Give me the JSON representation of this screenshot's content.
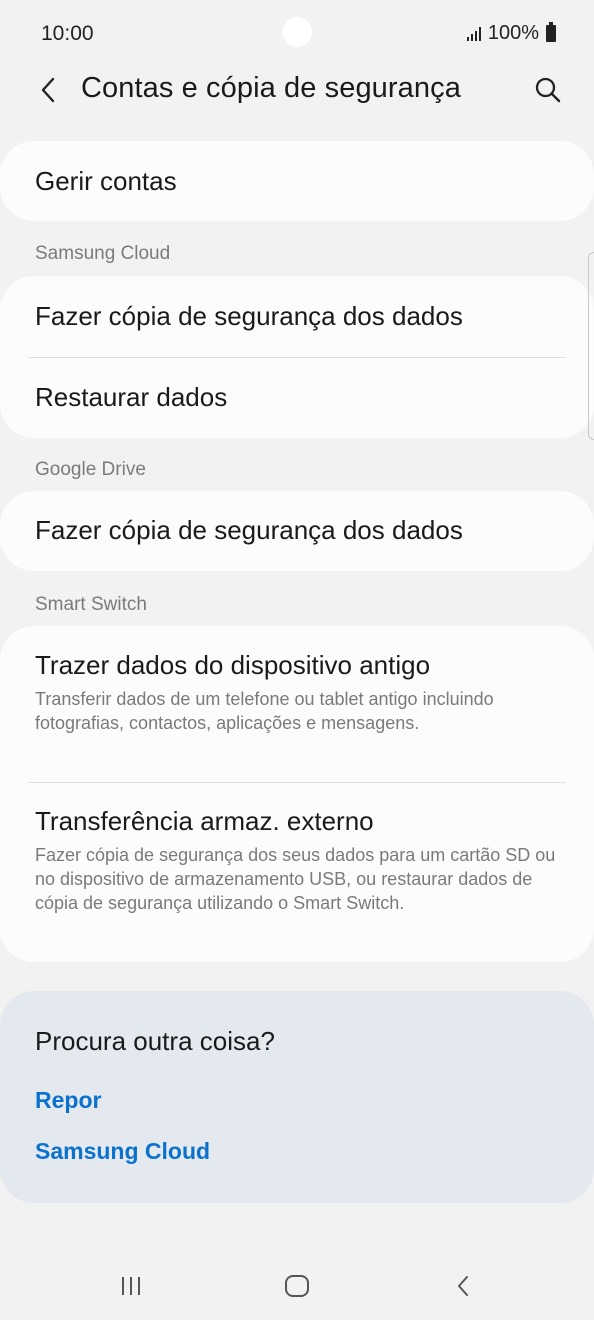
{
  "status_bar": {
    "time": "10:00",
    "battery_text": "100%"
  },
  "header": {
    "title": "Contas e cópia de segurança"
  },
  "account": {
    "manage_label": "Gerir contas"
  },
  "samsung_cloud": {
    "section_label": "Samsung Cloud",
    "backup_label": "Fazer cópia de segurança dos dados",
    "restore_label": "Restaurar dados"
  },
  "google_drive": {
    "section_label": "Google Drive",
    "backup_label": "Fazer cópia de segurança dos dados"
  },
  "smart_switch": {
    "section_label": "Smart Switch",
    "items": [
      {
        "title": "Trazer dados do dispositivo antigo",
        "desc": "Transferir dados de um telefone ou tablet antigo incluindo fotografias, contactos, aplicações e mensagens."
      },
      {
        "title": "Transferência armaz. externo",
        "desc": "Fazer cópia de segurança dos seus dados para um cartão SD ou no dispositivo de armazenamento USB, ou restaurar dados de cópia de segurança utilizando o Smart Switch."
      }
    ]
  },
  "suggestions": {
    "title": "Procura outra coisa?",
    "links": [
      "Repor",
      "Samsung Cloud"
    ]
  },
  "icons": {
    "back": "back-arrow-icon",
    "search": "search-icon",
    "recents": "recents-icon",
    "home": "home-icon",
    "nav_back": "nav-back-icon"
  },
  "colors": {
    "link": "#0a72cc",
    "background": "#f2f2f2",
    "suggest_background": "#e4e9f0"
  }
}
